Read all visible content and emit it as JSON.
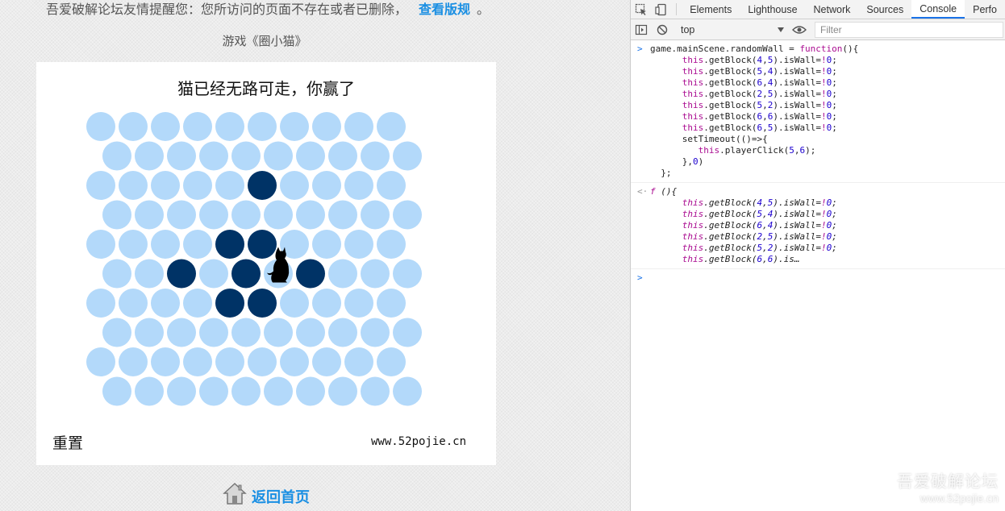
{
  "page": {
    "notice_text": "吾爱破解论坛友情提醒您：您所访问的页面不存在或者已删除，",
    "notice_link": "查看版规",
    "notice_end": "。",
    "game_title": "游戏《圈小猫》",
    "home_link": "返回首页"
  },
  "game": {
    "status": "猫已经无路可走，你赢了",
    "reset_label": "重置",
    "site_url": "www.52pojie.cn",
    "rows": 10,
    "cols": 10,
    "walls": [
      [
        5,
        2
      ],
      [
        4,
        4
      ],
      [
        5,
        4
      ],
      [
        2,
        5
      ],
      [
        4,
        5
      ],
      [
        6,
        5
      ],
      [
        4,
        6
      ],
      [
        5,
        6
      ]
    ],
    "cat": [
      5,
      5
    ],
    "colors": {
      "empty": "#b3d9fa",
      "wall": "#003366",
      "cat": "#000000"
    }
  },
  "devtools": {
    "tabs": [
      "Elements",
      "Lighthouse",
      "Network",
      "Sources",
      "Console",
      "Perfo"
    ],
    "active_tab": "Console",
    "context": "top",
    "filter_placeholder": "Filter",
    "input_lines": [
      "game.mainScene.randomWall = function(){",
      "      this.getBlock(4,5).isWall=!0;",
      "      this.getBlock(5,4).isWall=!0;",
      "      this.getBlock(6,4).isWall=!0;",
      "      this.getBlock(2,5).isWall=!0;",
      "      this.getBlock(5,2).isWall=!0;",
      "      this.getBlock(6,6).isWall=!0;",
      "      this.getBlock(6,5).isWall=!0;",
      "      setTimeout(()=>{",
      "         this.playerClick(5,6);",
      "      },0)",
      "  };"
    ],
    "output_lines": [
      "f (){",
      "      this.getBlock(4,5).isWall=!0;",
      "      this.getBlock(5,4).isWall=!0;",
      "      this.getBlock(6,4).isWall=!0;",
      "      this.getBlock(2,5).isWall=!0;",
      "      this.getBlock(5,2).isWall=!0;",
      "      this.getBlock(6,6).is…"
    ],
    "prompt_symbol": ">",
    "result_symbol": "<·"
  },
  "watermark": {
    "title": "吾爱破解论坛",
    "url": "www.52pojie.cn"
  }
}
